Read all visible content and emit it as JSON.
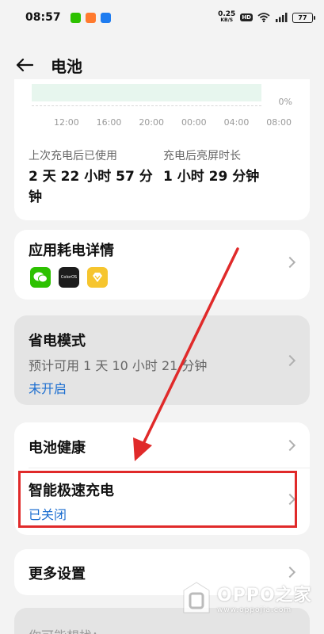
{
  "status_bar": {
    "time": "08:57",
    "net_speed_value": "0.25",
    "net_speed_unit": "KB/S",
    "hd_badge": "HD",
    "battery_level": "77",
    "app_colors": [
      "#2dc100",
      "#ff7a2e",
      "#1e7cf0"
    ]
  },
  "header": {
    "back_icon": "back-arrow-icon",
    "title": "电池"
  },
  "chart_data": {
    "type": "area",
    "x": [
      "12:00",
      "16:00",
      "20:00",
      "00:00",
      "04:00",
      "08:00"
    ],
    "y_tick_label": "0%",
    "series_color": "#e7f6ee"
  },
  "usage": {
    "since_charge_label": "上次充电后已使用",
    "since_charge_value": "2 天 22 小时 57 分钟",
    "screen_on_label": "充电后亮屏时长",
    "screen_on_value": "1 小时 29 分钟"
  },
  "app_usage": {
    "title": "应用耗电详情",
    "icons": [
      "wechat-icon",
      "coloros-icon",
      "theme-store-icon"
    ],
    "coloros_text": "ColorOS"
  },
  "power_saving": {
    "title": "省电模式",
    "subtitle": "预计可用 1 天 10 小时 21 分钟",
    "status": "未开启"
  },
  "battery_health": {
    "title": "电池健康"
  },
  "smart_charging": {
    "title": "智能极速充电",
    "status": "已关闭"
  },
  "more_settings": {
    "title": "更多设置"
  },
  "suggestions": {
    "title": "你可能想找："
  },
  "watermark": {
    "brand": "OPPO之家",
    "url": "www.oppojia.com"
  },
  "colors": {
    "accent": "#1e6fd0",
    "annotation": "#e02a2a"
  }
}
